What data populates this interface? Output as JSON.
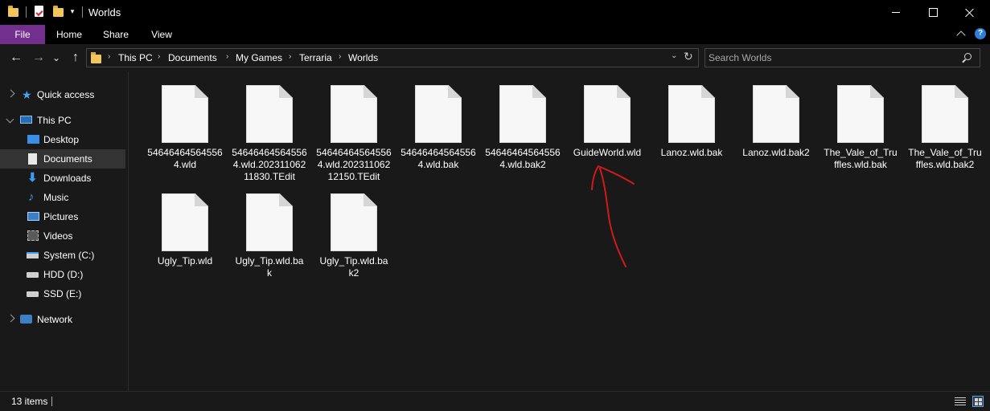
{
  "window": {
    "title": "Worlds"
  },
  "ribbon": {
    "tabs": [
      "File",
      "Home",
      "Share",
      "View"
    ],
    "help": "?"
  },
  "nav": {
    "back": "←",
    "forward": "→",
    "recent": "⌄",
    "up": "↑"
  },
  "breadcrumb": [
    "This PC",
    "Documents",
    "My Games",
    "Terraria",
    "Worlds"
  ],
  "search": {
    "placeholder": "Search Worlds"
  },
  "sidebar": {
    "quick_access": "Quick access",
    "this_pc": "This PC",
    "items": [
      "Desktop",
      "Documents",
      "Downloads",
      "Music",
      "Pictures",
      "Videos",
      "System (C:)",
      "HDD (D:)",
      "SSD (E:)"
    ],
    "network": "Network",
    "selected": "Documents"
  },
  "files": [
    {
      "line1": "54646464564556",
      "line2": "4.wld",
      "line3": ""
    },
    {
      "line1": "54646464564556",
      "line2": "4.wld.202311062",
      "line3": "11830.TEdit"
    },
    {
      "line1": "54646464564556",
      "line2": "4.wld.202311062",
      "line3": "12150.TEdit"
    },
    {
      "line1": "54646464564556",
      "line2": "4.wld.bak",
      "line3": ""
    },
    {
      "line1": "54646464564556",
      "line2": "4.wld.bak2",
      "line3": ""
    },
    {
      "line1": "GuideWorld.wld",
      "line2": "",
      "line3": ""
    },
    {
      "line1": "Lanoz.wld.bak",
      "line2": "",
      "line3": ""
    },
    {
      "line1": "Lanoz.wld.bak2",
      "line2": "",
      "line3": ""
    },
    {
      "line1": "The_Vale_of_Tru",
      "line2": "ffles.wld.bak",
      "line3": ""
    },
    {
      "line1": "The_Vale_of_Tru",
      "line2": "ffles.wld.bak2",
      "line3": ""
    },
    {
      "line1": "Ugly_Tip.wld",
      "line2": "",
      "line3": ""
    },
    {
      "line1": "Ugly_Tip.wld.ba",
      "line2": "k",
      "line3": ""
    },
    {
      "line1": "Ugly_Tip.wld.ba",
      "line2": "k2",
      "line3": ""
    }
  ],
  "status": {
    "item_count": "13 items"
  },
  "colors": {
    "file_tab": "#722f8e",
    "annotation": "#d11a1a",
    "selection": "#333333"
  }
}
